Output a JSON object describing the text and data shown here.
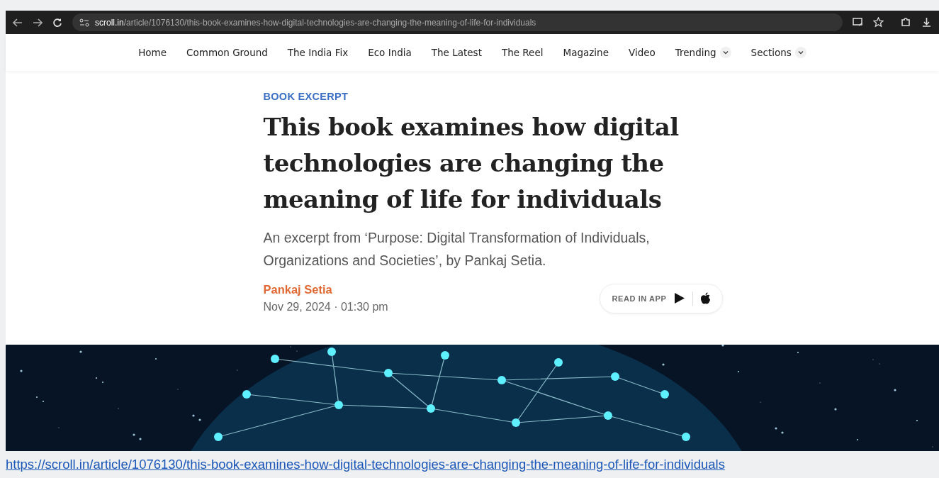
{
  "browser": {
    "domain": "scroll.in",
    "path": "/article/1076130/this-book-examines-how-digital-technologies-are-changing-the-meaning-of-life-for-individuals"
  },
  "nav": [
    {
      "label": "Home",
      "dropdown": false
    },
    {
      "label": "Common Ground",
      "dropdown": false
    },
    {
      "label": "The India Fix",
      "dropdown": false
    },
    {
      "label": "Eco India",
      "dropdown": false
    },
    {
      "label": "The Latest",
      "dropdown": false
    },
    {
      "label": "The Reel",
      "dropdown": false
    },
    {
      "label": "Magazine",
      "dropdown": false
    },
    {
      "label": "Video",
      "dropdown": false
    },
    {
      "label": "Trending",
      "dropdown": true
    },
    {
      "label": "Sections",
      "dropdown": true
    }
  ],
  "article": {
    "category": "BOOK EXCERPT",
    "title": "This book examines how digital technologies are changing the meaning of life for individuals",
    "subtitle": "An excerpt from ‘Purpose: Digital Transformation of Individuals, Organizations and Societies’, by Pankaj Setia.",
    "author": "Pankaj Setia",
    "date": "Nov 29, 2024 · 01:30 pm",
    "read_in_app": "READ IN APP"
  },
  "caption_link": "https://scroll.in/article/1076130/this-book-examines-how-digital-technologies-are-changing-the-meaning-of-life-for-individuals"
}
